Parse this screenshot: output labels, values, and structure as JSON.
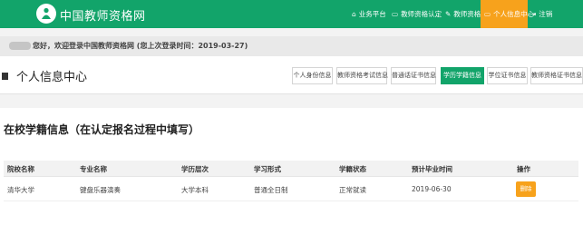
{
  "site": {
    "title": "中国教师资格网"
  },
  "topnav": [
    {
      "icon": "home-icon",
      "label": "业务平台"
    },
    {
      "icon": "monitor-icon",
      "label": "教师资格认定"
    },
    {
      "icon": "edit-icon",
      "label": "教师资格定期注册"
    },
    {
      "icon": "monitor-icon",
      "label": "个人信息中心",
      "active": true
    },
    {
      "icon": "logout-icon",
      "label": "注销"
    }
  ],
  "welcome": {
    "text": "您好，欢迎登录中国教师资格网 (您上次登录时间：2019-03-27)"
  },
  "header": {
    "title": "个人信息中心"
  },
  "tabs": [
    {
      "label": "个人身份信息"
    },
    {
      "label": "教师资格考试信息"
    },
    {
      "label": "普通话证书信息"
    },
    {
      "label": "学历学籍信息",
      "active": true
    },
    {
      "label": "学位证书信息"
    },
    {
      "label": "教师资格证书信息"
    }
  ],
  "section": {
    "title": "在校学籍信息（在认定报名过程中填写）"
  },
  "table": {
    "columns": [
      "院校名称",
      "专业名称",
      "学历层次",
      "学习形式",
      "学籍状态",
      "预计毕业时间",
      "操作"
    ],
    "rows": [
      {
        "cells": [
          "清华大学",
          "键盘乐器演奏",
          "大学本科",
          "普通全日制",
          "正常就读",
          "2019-06-30"
        ],
        "action": "删除"
      }
    ]
  },
  "colors": {
    "brand_green": "#12a46a",
    "accent_orange": "#f7a21c"
  }
}
